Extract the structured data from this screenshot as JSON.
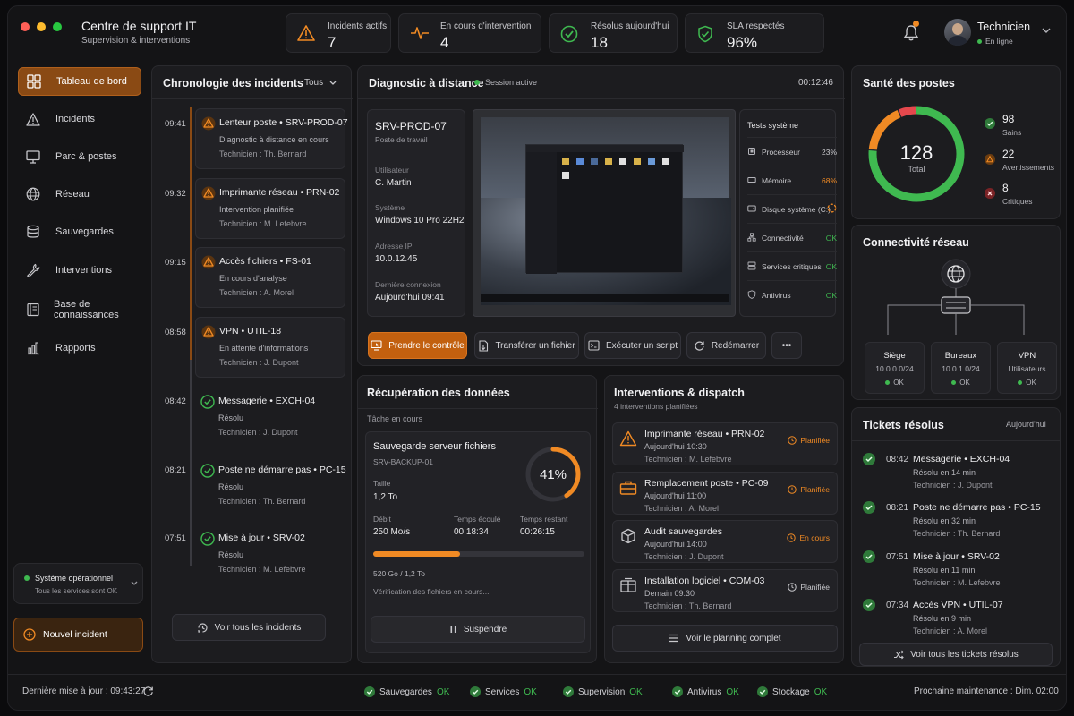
{
  "app": {
    "title": "Centre de support IT",
    "subtitle": "Supervision & interventions"
  },
  "stats": [
    {
      "label": "Incidents actifs",
      "value": "7"
    },
    {
      "label": "En cours d'intervention",
      "value": "4"
    },
    {
      "label": "Résolus aujourd'hui",
      "value": "18"
    },
    {
      "label": "SLA respectés",
      "value": "96%"
    }
  ],
  "user": {
    "name": "Technicien",
    "status": "En ligne"
  },
  "sidebar": {
    "items": [
      {
        "label": "Tableau de bord"
      },
      {
        "label": "Incidents"
      },
      {
        "label": "Parc & postes"
      },
      {
        "label": "Réseau"
      },
      {
        "label": "Sauvegardes"
      },
      {
        "label": "Interventions"
      },
      {
        "label": "Base de connaissances"
      },
      {
        "label": "Rapports"
      }
    ],
    "system_status": {
      "title": "Système opérationnel",
      "detail": "Tous les services sont OK"
    },
    "new_incident": "Nouvel incident"
  },
  "timeline": {
    "title": "Chronologie des incidents",
    "filter": "Tous",
    "items": [
      {
        "time": "09:41",
        "title": "Lenteur poste • SRV-PROD-07",
        "status": "Diagnostic à distance en cours",
        "tech": "Technicien : Th. Bernard"
      },
      {
        "time": "09:32",
        "title": "Imprimante réseau • PRN-02",
        "status": "Intervention planifiée",
        "tech": "Technicien : M. Lefebvre"
      },
      {
        "time": "09:15",
        "title": "Accès fichiers • FS-01",
        "status": "En cours d'analyse",
        "tech": "Technicien : A. Morel"
      },
      {
        "time": "08:58",
        "title": "VPN • UTIL-18",
        "status": "En attente d'informations",
        "tech": "Technicien : J. Dupont"
      },
      {
        "time": "08:42",
        "title": "Messagerie • EXCH-04",
        "status": "Résolu",
        "tech": "Technicien : J. Dupont"
      },
      {
        "time": "08:21",
        "title": "Poste ne démarre pas • PC-15",
        "status": "Résolu",
        "tech": "Technicien : Th. Bernard"
      },
      {
        "time": "07:51",
        "title": "Mise à jour • SRV-02",
        "status": "Résolu",
        "tech": "Technicien : M. Lefebvre"
      }
    ],
    "view_all": "Voir tous les incidents"
  },
  "diagnostic": {
    "title": "Diagnostic à distance",
    "session": "Session active",
    "timer": "00:12:46",
    "host": "SRV-PROD-07",
    "host_type": "Poste de travail",
    "fields": [
      {
        "label": "Utilisateur",
        "value": "C. Martin"
      },
      {
        "label": "Système",
        "value": "Windows 10 Pro 22H2"
      },
      {
        "label": "Adresse IP",
        "value": "10.0.12.45"
      },
      {
        "label": "Dernière connexion",
        "value": "Aujourd'hui 09:41"
      }
    ],
    "tests_title": "Tests système",
    "tests": [
      {
        "name": "Processeur",
        "value": "23%"
      },
      {
        "name": "Mémoire",
        "value": "68%"
      },
      {
        "name": "Disque système (C:)",
        "value": ""
      },
      {
        "name": "Connectivité",
        "value": "OK"
      },
      {
        "name": "Services critiques",
        "value": "OK"
      },
      {
        "name": "Antivirus",
        "value": "OK"
      }
    ],
    "actions": {
      "take_control": "Prendre le contrôle",
      "transfer": "Transférer un fichier",
      "script": "Exécuter un script",
      "restart": "Redémarrer",
      "more": "•••"
    }
  },
  "recovery": {
    "title": "Récupération des données",
    "task_label": "Tâche en cours",
    "job": "Sauvegarde serveur fichiers",
    "server": "SRV-BACKUP-01",
    "size_label": "Taille",
    "size": "1,2 To",
    "percent": "41%",
    "progress": 0.41,
    "rate_label": "Débit",
    "rate": "250 Mo/s",
    "elapsed_label": "Temps écoulé",
    "elapsed": "00:18:34",
    "remaining_label": "Temps restant",
    "remaining": "00:26:15",
    "amount": "520 Go / 1,2 To",
    "verify": "Vérification des fichiers en cours...",
    "pause": "Suspendre"
  },
  "dispatch": {
    "title": "Interventions & dispatch",
    "count": "4 interventions planifiées",
    "items": [
      {
        "title": "Imprimante réseau • PRN-02",
        "when": "Aujourd'hui 10:30",
        "tech": "Technicien : M. Lefebvre",
        "status": "Planifiée"
      },
      {
        "title": "Remplacement poste • PC-09",
        "when": "Aujourd'hui 11:00",
        "tech": "Technicien : A. Morel",
        "status": "Planifiée"
      },
      {
        "title": "Audit sauvegardes",
        "when": "Aujourd'hui 14:00",
        "tech": "Technicien : J. Dupont",
        "status": "En cours"
      },
      {
        "title": "Installation logiciel • COM-03",
        "when": "Demain 09:30",
        "tech": "Technicien : Th. Bernard",
        "status": "Planifiée"
      }
    ],
    "view_all": "Voir le planning complet"
  },
  "health": {
    "title": "Santé des postes",
    "total": "128",
    "total_label": "Total",
    "healthy": "98",
    "healthy_label": "Sains",
    "warnings": "22",
    "warnings_label": "Avertissements",
    "critical": "8",
    "critical_label": "Critiques",
    "colors": {
      "ok": "#3fb950",
      "warn": "#f08a24",
      "crit": "#e5484d"
    }
  },
  "network": {
    "title": "Connectivité réseau",
    "sites": [
      {
        "name": "Siège",
        "ip": "10.0.0.0/24",
        "status": "OK"
      },
      {
        "name": "Bureaux",
        "ip": "10.0.1.0/24",
        "status": "OK"
      },
      {
        "name": "VPN",
        "ip": "Utilisateurs",
        "status": "OK"
      }
    ]
  },
  "tickets": {
    "title": "Tickets résolus",
    "period": "Aujourd'hui",
    "items": [
      {
        "time": "08:42",
        "title": "Messagerie • EXCH-04",
        "resolved": "Résolu en 14 min",
        "tech": "Technicien : J. Dupont"
      },
      {
        "time": "08:21",
        "title": "Poste ne démarre pas • PC-15",
        "resolved": "Résolu en 32 min",
        "tech": "Technicien : Th. Bernard"
      },
      {
        "time": "07:51",
        "title": "Mise à jour • SRV-02",
        "resolved": "Résolu en 11 min",
        "tech": "Technicien : M. Lefebvre"
      },
      {
        "time": "07:34",
        "title": "Accès VPN • UTIL-07",
        "resolved": "Résolu en 9 min",
        "tech": "Technicien : A. Morel"
      }
    ],
    "view_all": "Voir tous les tickets résolus"
  },
  "footer": {
    "last_update": "Dernière mise à jour : 09:43:27",
    "services": [
      {
        "name": "Sauvegardes",
        "status": "OK"
      },
      {
        "name": "Services",
        "status": "OK"
      },
      {
        "name": "Supervision",
        "status": "OK"
      },
      {
        "name": "Antivirus",
        "status": "OK"
      },
      {
        "name": "Stockage",
        "status": "OK"
      }
    ],
    "maintenance": "Prochaine maintenance : Dim. 02:00"
  }
}
